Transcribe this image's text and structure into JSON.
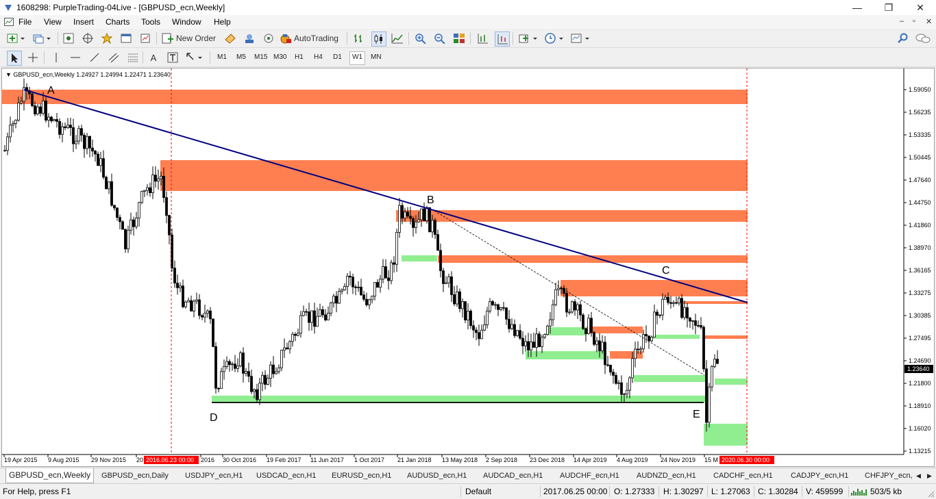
{
  "window": {
    "title": "1608298: PurpleTrading-04Live - [GBPUSD_ecn,Weekly]",
    "minimize": "—",
    "maximize": "❐",
    "close": "✕"
  },
  "menu": {
    "items": [
      "File",
      "View",
      "Insert",
      "Charts",
      "Tools",
      "Window",
      "Help"
    ],
    "mdi_minimize": "–",
    "mdi_restore": "▫",
    "mdi_close": "✕"
  },
  "toolbar": {
    "new_order": "New Order",
    "auto_trading": "AutoTrading"
  },
  "timeframes": [
    "M1",
    "M5",
    "M15",
    "M30",
    "H1",
    "H4",
    "D1",
    "W1",
    "MN"
  ],
  "active_timeframe": "W1",
  "chart": {
    "header": "GBPUSD_ecn,Weekly  1.24927 1.24994 1.22471 1.23640",
    "current_price": "1.23640",
    "price_labels": [
      "1.59050",
      "1.56235",
      "1.53335",
      "1.50445",
      "1.47640",
      "1.44750",
      "1.41860",
      "1.38970",
      "1.36165",
      "1.33275",
      "1.30385",
      "1.27495",
      "1.24690",
      "1.21800",
      "1.18910",
      "1.16020",
      "1.13215"
    ],
    "date_labels": [
      "19 Apr 2015",
      "9 Aug 2015",
      "29 Nov 2015",
      "20",
      "2016",
      "30 Oct 2016",
      "19 Feb 2017",
      "11 Jun 2017",
      "1 Oct 2017",
      "21 Jan 2018",
      "13 May 2018",
      "2 Sep 2018",
      "23 Dec 2018",
      "14 Apr 2019",
      "4 Aug 2019",
      "24 Nov 2019",
      "15 M"
    ],
    "date_marker_1": "2016.06.23 00:00",
    "date_marker_2": "2020.06.30 00:00",
    "points": [
      "A",
      "B",
      "C",
      "D",
      "E"
    ],
    "colors": {
      "supply_zone": "#ff7f50",
      "demand_zone": "#90ee90",
      "trendline": "#000080",
      "marker_red": "#ff0000",
      "candle": "#000000"
    }
  },
  "tabs": [
    "GBPUSD_ecn,Weekly",
    "GBPUSD_ecn,Daily",
    "USDJPY_ecn,H1",
    "USDCAD_ecn,H1",
    "EURUSD_ecn,H1",
    "AUDUSD_ecn,H1",
    "AUDCAD_ecn,H1",
    "AUDCHF_ecn,H1",
    "AUDNZD_ecn,H1",
    "CADCHF_ecn,H1",
    "CADJPY_ecn,H1",
    "CHFJPY_ecn,"
  ],
  "active_tab": "GBPUSD_ecn,Weekly",
  "status": {
    "help": "For Help, press F1",
    "profile": "Default",
    "datetime": "2017.06.25 00:00",
    "open": "O: 1.27333",
    "high": "H: 1.30297",
    "low": "L: 1.27063",
    "close": "C: 1.30284",
    "volume": "V: 459599",
    "traffic": "503/5 kb"
  }
}
